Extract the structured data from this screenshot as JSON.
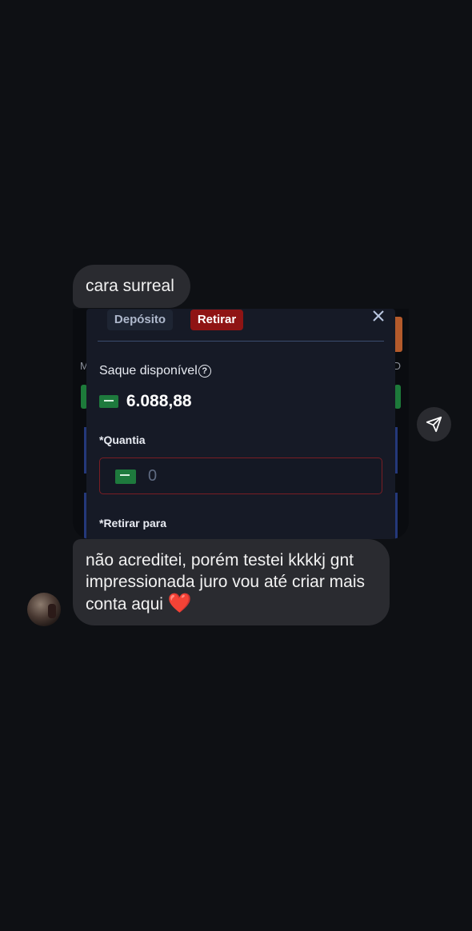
{
  "messages": [
    {
      "text": "cara surreal"
    },
    {
      "text": "não acreditei, porém testei kkkkj gnt impressionada juro vou até criar mais conta aqui",
      "emoji": "❤️"
    }
  ],
  "shared_screenshot": {
    "tabs": {
      "deposit_label": "Depósito",
      "withdraw_label": "Retirar",
      "active": "Retirar"
    },
    "available_label": "Saque disponível",
    "balance": "6.088,88",
    "amount_label": "*Quantia",
    "amount_value": "0",
    "withdraw_to_label": "*Retirar para",
    "background_letters": [
      "M",
      "D"
    ],
    "flag_icon": "saudi-flag-icon",
    "colors": {
      "withdraw_tab": "#8f1414",
      "input_border": "#7a1e24"
    }
  },
  "icons": {
    "help": "?",
    "close": "close-icon",
    "send": "send-icon"
  }
}
